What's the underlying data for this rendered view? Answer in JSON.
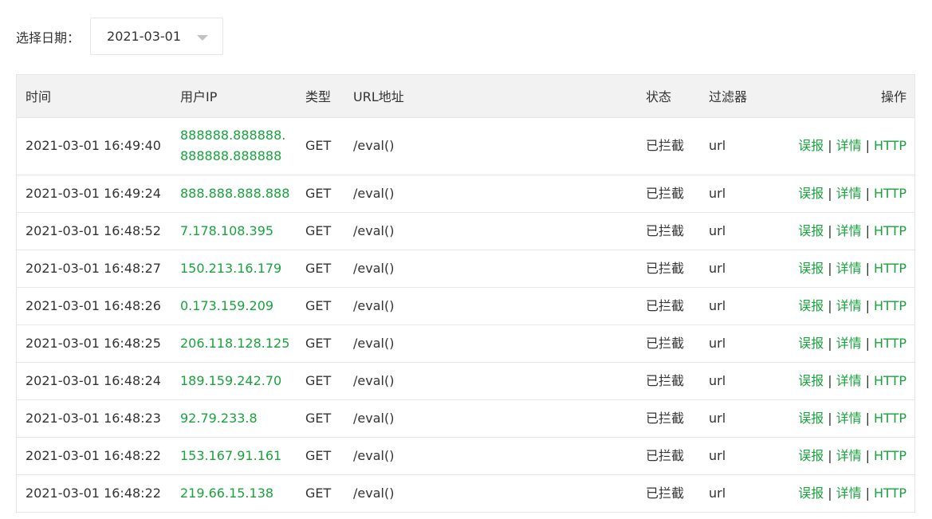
{
  "filter": {
    "label": "选择日期：",
    "selected_date": "2021-03-01"
  },
  "table": {
    "headers": {
      "time": "时间",
      "ip": "用户IP",
      "type": "类型",
      "url": "URL地址",
      "status": "状态",
      "filter": "过滤器",
      "actions": "操作"
    },
    "action_labels": {
      "report": "误报",
      "detail": "详情",
      "http": "HTTP",
      "separator": "|"
    },
    "rows": [
      {
        "time": "2021-03-01 16:49:40",
        "ip": "888888.888888.888888.888888",
        "type": "GET",
        "url": "/eval()",
        "status": "已拦截",
        "filter": "url"
      },
      {
        "time": "2021-03-01 16:49:24",
        "ip": "888.888.888.888",
        "type": "GET",
        "url": "/eval()",
        "status": "已拦截",
        "filter": "url"
      },
      {
        "time": "2021-03-01 16:48:52",
        "ip": "7.178.108.395",
        "type": "GET",
        "url": "/eval()",
        "status": "已拦截",
        "filter": "url"
      },
      {
        "time": "2021-03-01 16:48:27",
        "ip": "150.213.16.179",
        "type": "GET",
        "url": "/eval()",
        "status": "已拦截",
        "filter": "url"
      },
      {
        "time": "2021-03-01 16:48:26",
        "ip": "0.173.159.209",
        "type": "GET",
        "url": "/eval()",
        "status": "已拦截",
        "filter": "url"
      },
      {
        "time": "2021-03-01 16:48:25",
        "ip": "206.118.128.125",
        "type": "GET",
        "url": "/eval()",
        "status": "已拦截",
        "filter": "url"
      },
      {
        "time": "2021-03-01 16:48:24",
        "ip": "189.159.242.70",
        "type": "GET",
        "url": "/eval()",
        "status": "已拦截",
        "filter": "url"
      },
      {
        "time": "2021-03-01 16:48:23",
        "ip": "92.79.233.8",
        "type": "GET",
        "url": "/eval()",
        "status": "已拦截",
        "filter": "url"
      },
      {
        "time": "2021-03-01 16:48:22",
        "ip": "153.167.91.161",
        "type": "GET",
        "url": "/eval()",
        "status": "已拦截",
        "filter": "url"
      },
      {
        "time": "2021-03-01 16:48:22",
        "ip": "219.66.15.138",
        "type": "GET",
        "url": "/eval()",
        "status": "已拦截",
        "filter": "url"
      }
    ]
  },
  "colors": {
    "link": "#18a33d",
    "header_bg": "#f2f2f2",
    "border": "#e6e6e6"
  }
}
